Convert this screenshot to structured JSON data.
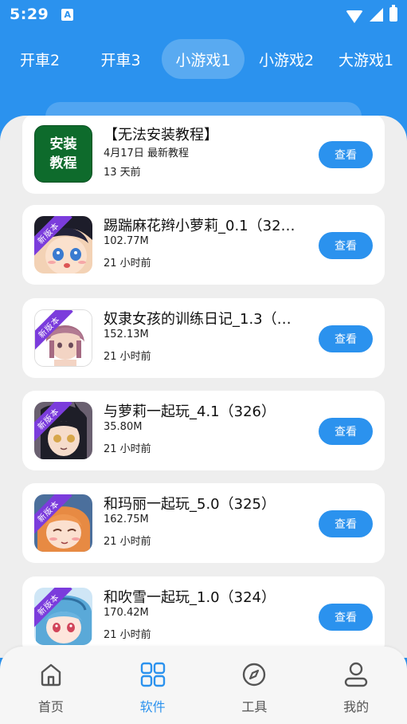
{
  "status_bar": {
    "time": "5:29",
    "a_badge": "A",
    "icons": [
      "wifi-icon",
      "signal-icon",
      "battery-icon"
    ]
  },
  "top_tabs": [
    {
      "label": "开車2",
      "active": false
    },
    {
      "label": "开車3",
      "active": false
    },
    {
      "label": "小游戏1",
      "active": true
    },
    {
      "label": "小游戏2",
      "active": false
    },
    {
      "label": "大游戏1",
      "active": false
    }
  ],
  "install_icon_text": [
    "安装",
    "教程"
  ],
  "items": [
    {
      "title": "【无法安装教程】",
      "size": "4月17日 最新教程",
      "time": "13 天前",
      "button": "查看",
      "badge": ""
    },
    {
      "title": "踢踹麻花辫小萝莉_0.1（32…",
      "size": "102.77M",
      "time": "21 小时前",
      "button": "查看",
      "badge": "新版本"
    },
    {
      "title": "奴隶女孩的训练日记_1.3（…",
      "size": "152.13M",
      "time": "21 小时前",
      "button": "查看",
      "badge": "新版本"
    },
    {
      "title": "与萝莉一起玩_4.1（326）",
      "size": "35.80M",
      "time": "21 小时前",
      "button": "查看",
      "badge": "新版本"
    },
    {
      "title": "和玛丽一起玩_5.0（325）",
      "size": "162.75M",
      "time": "21 小时前",
      "button": "查看",
      "badge": "新版本"
    },
    {
      "title": "和吹雪一起玩_1.0（324）",
      "size": "170.42M",
      "time": "21 小时前",
      "button": "查看",
      "badge": "新版本"
    }
  ],
  "bottom_nav": [
    {
      "label": "首页",
      "icon": "home-icon",
      "active": false
    },
    {
      "label": "软件",
      "icon": "grid-icon",
      "active": true
    },
    {
      "label": "工具",
      "icon": "compass-icon",
      "active": false
    },
    {
      "label": "我的",
      "icon": "user-icon",
      "active": false
    }
  ],
  "colors": {
    "primary": "#2b92ee",
    "install_green": "#0e6b2c",
    "badge_purple": "#7b3cdc",
    "panel_bg": "#eeeeee"
  }
}
